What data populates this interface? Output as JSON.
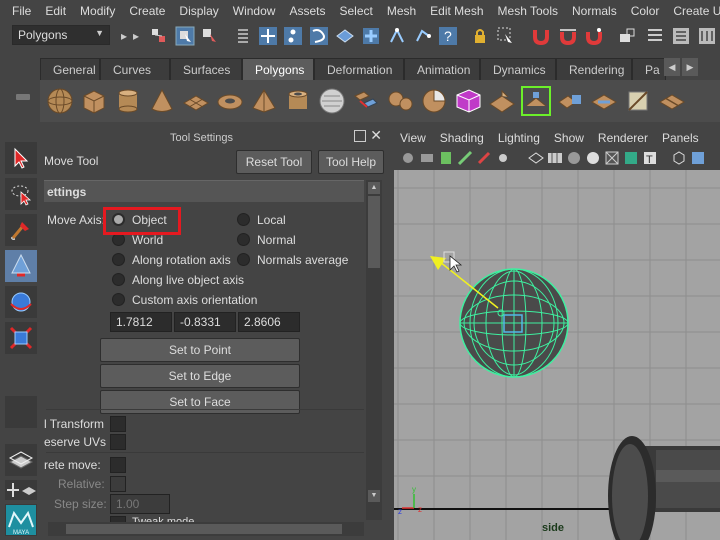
{
  "menubar": {
    "items": [
      "File",
      "Edit",
      "Modify",
      "Create",
      "Display",
      "Window",
      "Assets",
      "Select",
      "Mesh",
      "Edit Mesh",
      "Mesh Tools",
      "Normals",
      "Color",
      "Create UVs"
    ]
  },
  "statusline": {
    "mode": "Polygons"
  },
  "shelf": {
    "tabs": [
      "General",
      "Curves",
      "Surfaces",
      "Polygons",
      "Deformation",
      "Animation",
      "Dynamics",
      "Rendering",
      "Pa"
    ],
    "active_tab": "Polygons",
    "icons": [
      "poly-sphere-icon",
      "poly-cube-icon",
      "poly-cylinder-icon",
      "poly-cone-icon",
      "poly-plane-icon",
      "poly-torus-icon",
      "poly-pyramid-icon",
      "poly-pipe-icon",
      "poly-helix-icon",
      "combine-icon",
      "separate-icon",
      "extract-icon",
      "smooth-icon",
      "boolean-icon",
      "extrude-icon",
      "bridge-icon",
      "append-icon",
      "split-icon",
      "insert-edgeloop-icon",
      "offset-edgeloop-icon",
      "merge-icon"
    ]
  },
  "toolbox": {
    "tools": [
      "select-tool-icon",
      "lasso-tool-icon",
      "paint-select-tool-icon",
      "move-tool-icon",
      "rotate-tool-icon",
      "scale-tool-icon",
      "last-tool-icon",
      "layout-single-icon",
      "layout-four-icon",
      "maya-logo-icon"
    ]
  },
  "tool_settings": {
    "panel_title": "Tool Settings",
    "tool_name": "Move Tool",
    "reset_label": "Reset Tool",
    "help_label": "Tool Help",
    "section_title": "ettings",
    "move_axis_label": "Move Axis:",
    "axis_options": {
      "object": "Object",
      "local": "Local",
      "world": "World",
      "normal": "Normal",
      "along_rotation": "Along rotation axis",
      "normals_average": "Normals average",
      "along_live": "Along live object axis",
      "custom": "Custom axis orientation"
    },
    "selected_axis": "Object",
    "axis_values": [
      "1.7812",
      "-0.8331",
      "2.8606"
    ],
    "set_point": "Set to Point",
    "set_edge": "Set to Edge",
    "set_face": "Set to Face",
    "transform_label": "l Transform",
    "preserve_uvs_label": "eserve UVs",
    "discrete_label": "rete move:",
    "relative_label": "Relative:",
    "step_size_label": "Step size:",
    "step_size_value": "1.00",
    "tweak_mode_label": "Tweak mode"
  },
  "viewport_panel": {
    "menu": [
      "View",
      "Shading",
      "Lighting",
      "Show",
      "Renderer",
      "Panels"
    ],
    "camera_label": "side",
    "colors": {
      "background": "#a3a3a3",
      "grid": "#8e8e8e",
      "wireframe": "#3ef0a0",
      "highlight": "#e51920"
    }
  }
}
